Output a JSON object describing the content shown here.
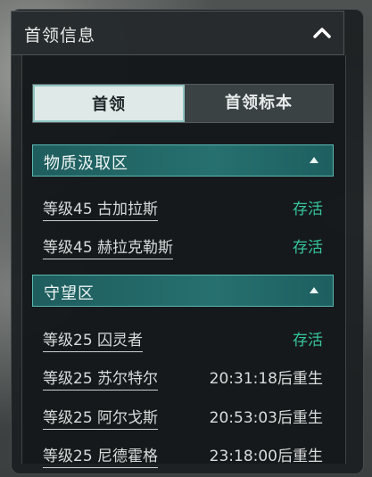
{
  "panel": {
    "title": "首领信息"
  },
  "tabs": [
    {
      "label": "首领",
      "active": true
    },
    {
      "label": "首领标本",
      "active": false
    }
  ],
  "sections": [
    {
      "title": "物质汲取区",
      "bosses": [
        {
          "name": "等级45 古加拉斯",
          "status": "存活",
          "state": "alive"
        },
        {
          "name": "等级45 赫拉克勒斯",
          "status": "存活",
          "state": "alive"
        }
      ]
    },
    {
      "title": "守望区",
      "bosses": [
        {
          "name": "等级25 囚灵者",
          "status": "存活",
          "state": "alive"
        },
        {
          "name": "等级25 苏尔特尔",
          "status": "20:31:18后重生",
          "state": "respawn"
        },
        {
          "name": "等级25 阿尔戈斯",
          "status": "20:53:03后重生",
          "state": "respawn"
        },
        {
          "name": "等级25 尼德霍格",
          "status": "23:18:00后重生",
          "state": "respawn"
        }
      ]
    }
  ],
  "colors": {
    "alive": "#35c59d",
    "section_bg": "#26706f",
    "tab_active_bg": "#dfe9e7"
  },
  "icons": {
    "collapse": "chevron-up-icon",
    "section_toggle": "triangle-up-icon"
  }
}
